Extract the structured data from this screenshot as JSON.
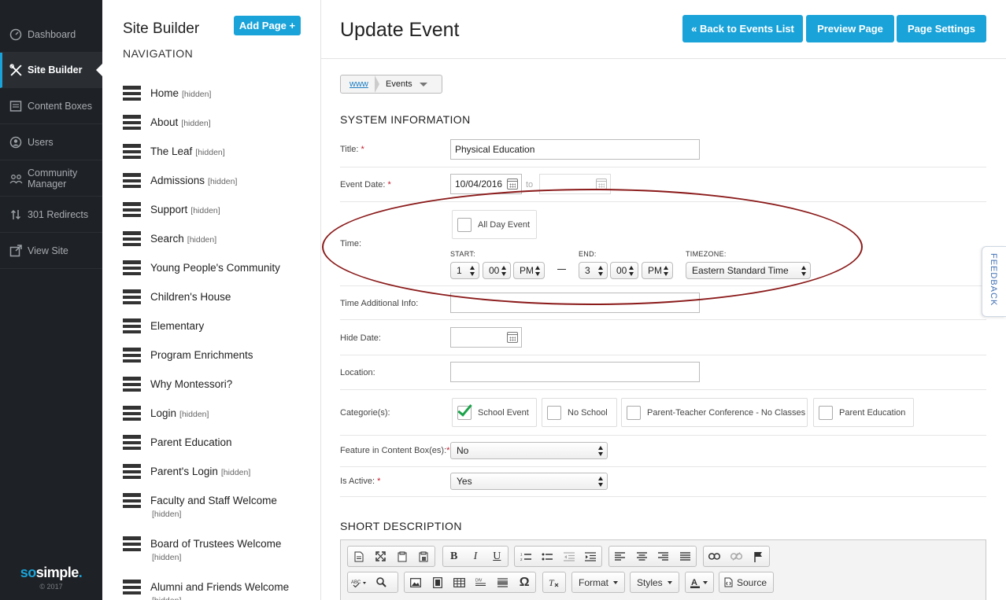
{
  "sidebar": {
    "items": [
      {
        "label": "Dashboard",
        "icon": "dashboard-icon"
      },
      {
        "label": "Site Builder",
        "icon": "tools-icon"
      },
      {
        "label": "Content Boxes",
        "icon": "content-box-icon"
      },
      {
        "label": "Users",
        "icon": "user-icon"
      },
      {
        "label": "Community Manager",
        "icon": "community-icon"
      },
      {
        "label": "301 Redirects",
        "icon": "redirect-icon"
      },
      {
        "label": "View Site",
        "icon": "external-link-icon"
      }
    ],
    "brand_so": "so",
    "brand_simple": "simple",
    "brand_dot": ".",
    "copyright": "© 2017"
  },
  "nav_panel": {
    "title": "Site Builder",
    "add_button": "Add Page +",
    "subtitle": "NAVIGATION",
    "hidden_tag": "[hidden]",
    "pages": [
      {
        "name": "Home",
        "hidden": true
      },
      {
        "name": "About",
        "hidden": true
      },
      {
        "name": "The Leaf",
        "hidden": true
      },
      {
        "name": "Admissions",
        "hidden": true
      },
      {
        "name": "Support",
        "hidden": true
      },
      {
        "name": "Search",
        "hidden": true
      },
      {
        "name": "Young People's Community",
        "hidden": false
      },
      {
        "name": "Children's House",
        "hidden": false
      },
      {
        "name": "Elementary",
        "hidden": false
      },
      {
        "name": "Program Enrichments",
        "hidden": false
      },
      {
        "name": "Why Montessori?",
        "hidden": false
      },
      {
        "name": "Login",
        "hidden": true
      },
      {
        "name": "Parent Education",
        "hidden": false
      },
      {
        "name": "Parent's Login",
        "hidden": true
      },
      {
        "name": "Faculty and Staff Welcome",
        "hidden": true
      },
      {
        "name": "Board of Trustees Welcome",
        "hidden": true
      },
      {
        "name": "Alumni and Friends Welcome",
        "hidden": true
      }
    ]
  },
  "main": {
    "title": "Update Event",
    "buttons": {
      "back": "« Back to Events List",
      "preview": "Preview Page",
      "settings": "Page Settings"
    },
    "breadcrumb": {
      "root": "www",
      "current": "Events"
    },
    "system_info_heading": "SYSTEM INFORMATION",
    "fields": {
      "title_label": "Title:",
      "title_value": "Physical Education",
      "event_date_label": "Event Date:",
      "event_date_value": "10/04/2016",
      "event_date_to": "to",
      "time_label": "Time:",
      "all_day_label": "All Day Event",
      "start_label": "START:",
      "end_label": "END:",
      "timezone_label": "TIMEZONE:",
      "start_hour": "1",
      "start_min": "00",
      "start_ampm": "PM",
      "end_hour": "3",
      "end_min": "00",
      "end_ampm": "PM",
      "timezone": "Eastern Standard Time",
      "time_additional_label": "Time Additional Info:",
      "hide_date_label": "Hide Date:",
      "location_label": "Location:",
      "categories_label": "Categorie(s):",
      "categories": [
        {
          "label": "School Event",
          "checked": true
        },
        {
          "label": "No School",
          "checked": false
        },
        {
          "label": "Parent-Teacher Conference - No Classes",
          "checked": false
        },
        {
          "label": "Parent Education",
          "checked": false
        }
      ],
      "feature_label": "Feature in Content Box(es):",
      "feature_value": "No",
      "active_label": "Is Active:",
      "active_value": "Yes",
      "required_mark": "*"
    },
    "short_description_heading": "SHORT DESCRIPTION",
    "editor": {
      "format": "Format",
      "styles": "Styles",
      "source": "Source"
    }
  },
  "feedback_tab": "FEEDBACK",
  "colors": {
    "accent": "#1aa3d9",
    "sidebar_bg": "#1e2125",
    "annotation_ellipse": "#8b1a1a",
    "required": "#c2182b"
  }
}
